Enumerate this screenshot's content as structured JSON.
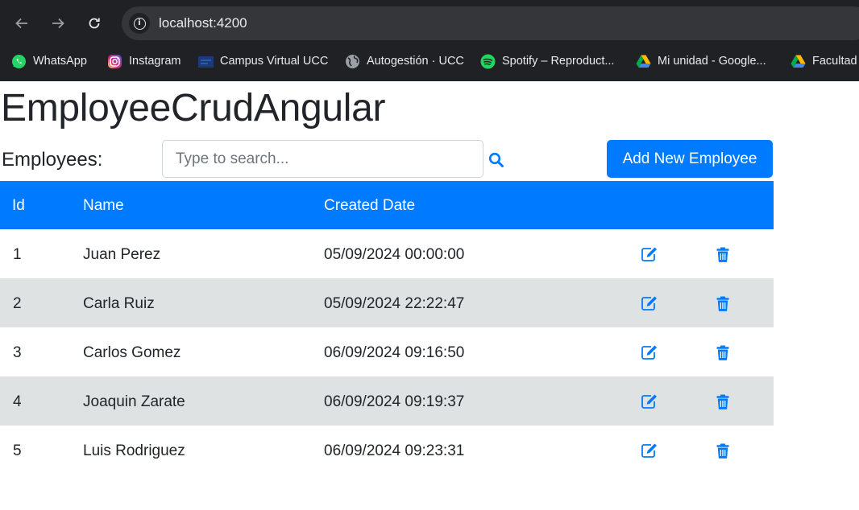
{
  "browser": {
    "url": "localhost:4200",
    "bookmarks": [
      {
        "label": "WhatsApp",
        "icon": "whatsapp-icon"
      },
      {
        "label": "Instagram",
        "icon": "instagram-icon"
      },
      {
        "label": "Campus Virtual UCC",
        "icon": "campus-icon"
      },
      {
        "label": "Autogestión · UCC",
        "icon": "globe-icon"
      },
      {
        "label": "Spotify – Reproduct...",
        "icon": "spotify-icon"
      },
      {
        "label": "Mi unidad - Google...",
        "icon": "google-drive-icon"
      },
      {
        "label": "Facultad",
        "icon": "google-drive-icon"
      }
    ]
  },
  "page": {
    "title": "EmployeeCrudAngular",
    "employees_label": "Employees:",
    "search_placeholder": "Type to search...",
    "add_button": "Add New Employee"
  },
  "table": {
    "headers": {
      "id": "Id",
      "name": "Name",
      "created": "Created Date"
    },
    "rows": [
      {
        "id": "1",
        "name": "Juan Perez",
        "created": "05/09/2024 00:00:00"
      },
      {
        "id": "2",
        "name": "Carla Ruiz",
        "created": "05/09/2024 22:22:47"
      },
      {
        "id": "3",
        "name": "Carlos Gomez",
        "created": "06/09/2024 09:16:50"
      },
      {
        "id": "4",
        "name": "Joaquin Zarate",
        "created": "06/09/2024 09:19:37"
      },
      {
        "id": "5",
        "name": "Luis Rodriguez",
        "created": "06/09/2024 09:23:31"
      }
    ]
  },
  "colors": {
    "primary": "#007bff",
    "row_alt": "#dee2e2",
    "chrome_bg": "#202124"
  }
}
